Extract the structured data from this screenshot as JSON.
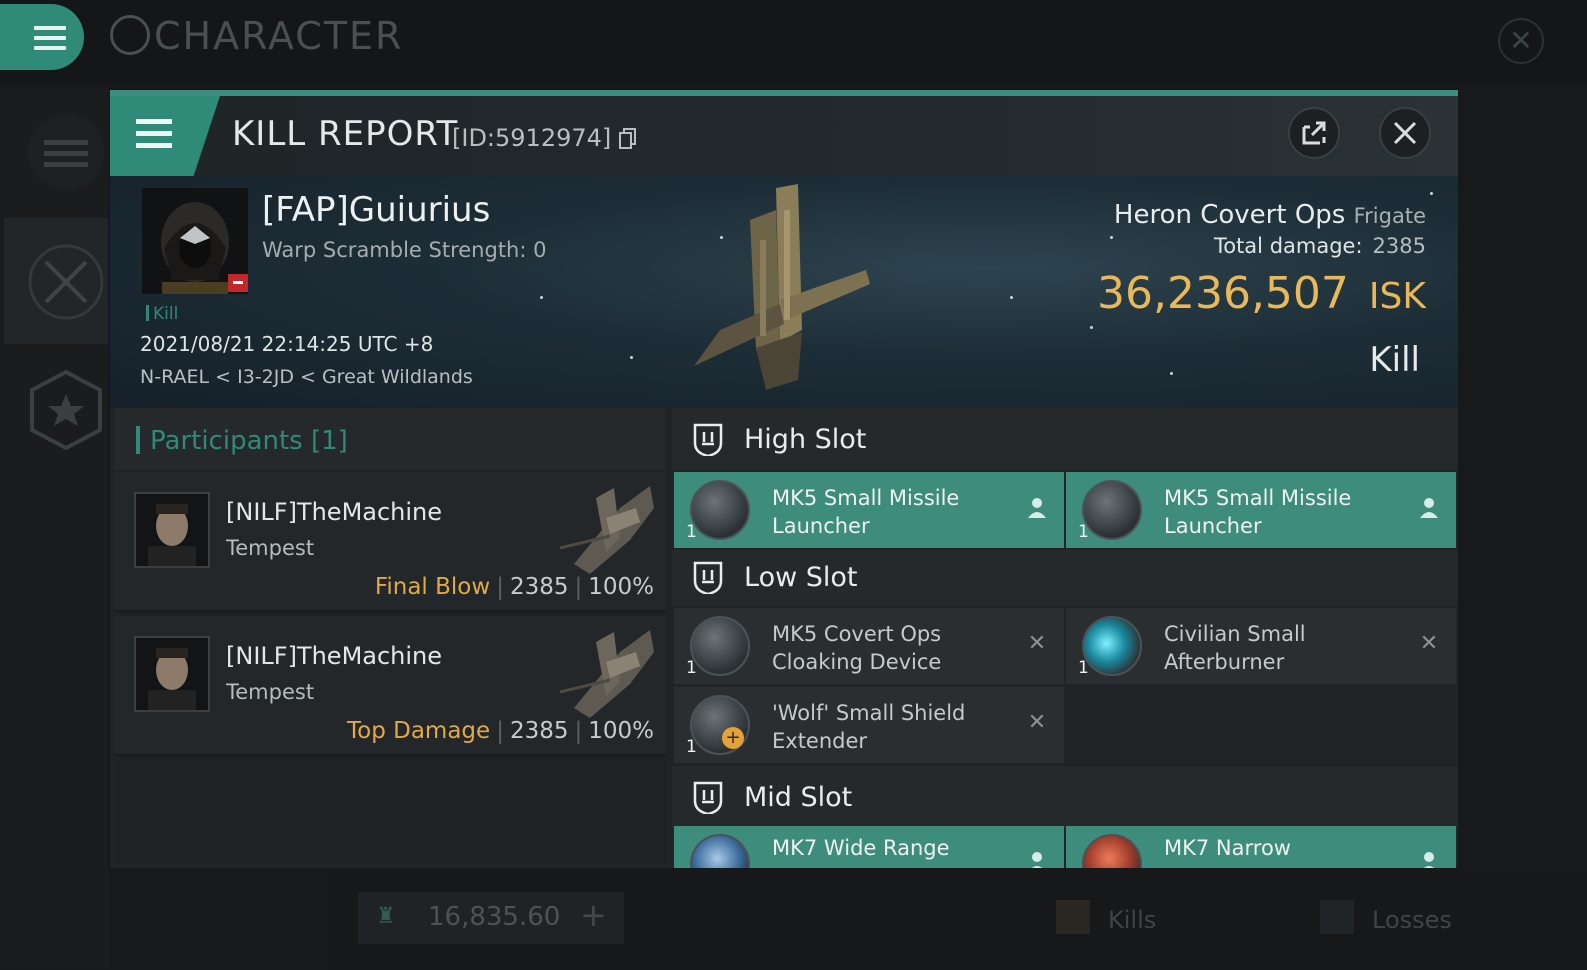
{
  "topbar": {
    "title": "CHARACTER"
  },
  "bottom": {
    "isk_balance": "16,835.60",
    "tabs": [
      "Kills",
      "Losses"
    ]
  },
  "report": {
    "title": "KILL REPORT",
    "id_label": "[ID:5912974]",
    "victim": {
      "name": "[FAP]Guiurius",
      "warp_scramble": "Warp Scramble Strength: 0",
      "tag": "Kill",
      "datetime": "2021/08/21 22:14:25 UTC +8",
      "location": "N-RAEL < I3-2JD < Great Wildlands"
    },
    "ship": {
      "name": "Heron Covert Ops",
      "class": "Frigate",
      "total_damage_label": "Total damage:",
      "total_damage": "2385",
      "isk_value": "36,236,507",
      "isk_unit": "ISK",
      "result": "Kill"
    },
    "participants": {
      "header": "Participants [1]",
      "rows": [
        {
          "name": "[NILF]TheMachine",
          "ship": "Tempest",
          "label": "Final Blow",
          "damage": "2385",
          "percent": "100%"
        },
        {
          "name": "[NILF]TheMachine",
          "ship": "Tempest",
          "label": "Top Damage",
          "damage": "2385",
          "percent": "100%"
        }
      ]
    },
    "slots": {
      "high": {
        "title": "High Slot",
        "modules": [
          {
            "name": "MK5 Small Missile Launcher",
            "qty": "1",
            "state": "fitted"
          },
          {
            "name": "MK5 Small Missile Launcher",
            "qty": "1",
            "state": "fitted"
          }
        ]
      },
      "low": {
        "title": "Low Slot",
        "modules": [
          {
            "name": "MK5 Covert Ops Cloaking Device",
            "qty": "1",
            "state": "destroyed"
          },
          {
            "name": "Civilian Small Afterburner",
            "qty": "1",
            "state": "destroyed"
          },
          {
            "name": "'Wolf' Small Shield Extender",
            "qty": "1",
            "state": "destroyed"
          }
        ]
      },
      "mid": {
        "title": "Mid Slot",
        "modules": [
          {
            "name": "MK7 Wide Range",
            "state": "fitted"
          },
          {
            "name": "MK7 Narrow",
            "state": "fitted"
          }
        ]
      }
    }
  },
  "colors": {
    "accent": "#2f8a78",
    "isk": "#e8b85a",
    "label_orange": "#e0a94a"
  },
  "icons": [
    "menu-icon",
    "character-icon",
    "close-icon",
    "external-link-icon",
    "copy-icon",
    "pilot-icon",
    "destroyed-x-icon",
    "slot-shield-icon",
    "star-icon",
    "crossed-swords-icon"
  ]
}
